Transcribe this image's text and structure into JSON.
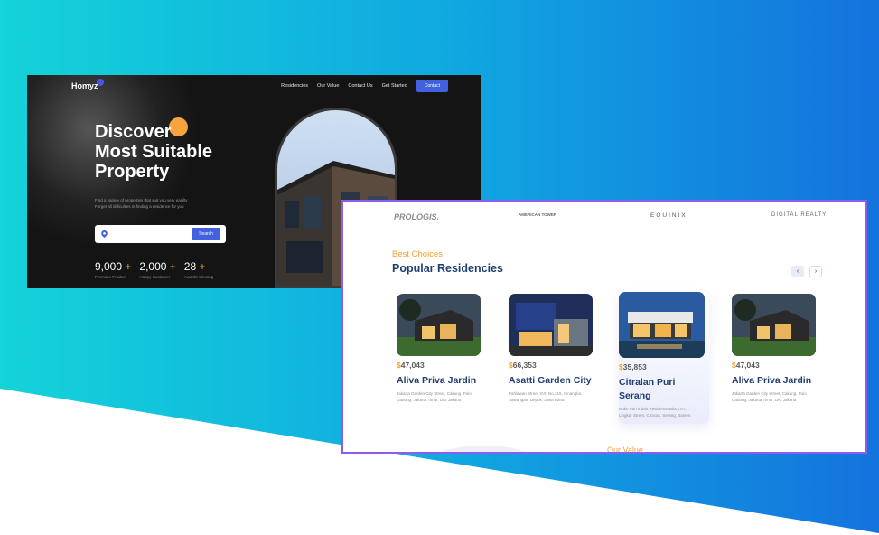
{
  "hero": {
    "logo": "Homyz",
    "nav": [
      "Residencies",
      "Our Value",
      "Contact Us",
      "Get Started"
    ],
    "contact_button": "Contact",
    "headline": [
      "Discover",
      "Most Suitable",
      "Property"
    ],
    "description": [
      "Find a variety of properties that suit you very easilty",
      "Forget all difficulties in finding a residence for you"
    ],
    "search_button": "Search",
    "stats": [
      {
        "value": "9,000",
        "plus": "+",
        "label": "Premium Product"
      },
      {
        "value": "2,000",
        "plus": "+",
        "label": "Happy Customer"
      },
      {
        "value": "28",
        "plus": "+",
        "label": "Awards Winning"
      }
    ]
  },
  "residencies": {
    "partners": [
      "PROLOGIS.",
      "AMERICAN TOWER",
      "EQUINIX",
      "DIGITAL REALTY"
    ],
    "subtitle": "Best Choices",
    "title": "Popular Residencies",
    "prev_icon": "‹",
    "next_icon": "›",
    "cards": [
      {
        "dollar": "$",
        "price": "47,043",
        "name": "Aliva Priva Jardin",
        "address": "Jakarta Garden City Street, Cakung. Pulo Gadung, Jakarta Timur, DKI Jakarta"
      },
      {
        "dollar": "$",
        "price": "66,353",
        "name": "Asatti Garden City",
        "address": "Pahlawan Street XVII No.215, Cinangka, Sawangan, Depok, Jawa Barat"
      },
      {
        "dollar": "$",
        "price": "35,853",
        "name": "Citralan Puri Serang",
        "address": "Ruko Puri Indah Residence Block A7, Lingkar Street, Ciracas, Serang, Banten"
      },
      {
        "dollar": "$",
        "price": "47,043",
        "name": "Aliva Priva Jardin",
        "address": "Jakarta Garden City Street, Cakung. Pulo Gadung, Jakarta Timur, DKI Jakarta"
      }
    ],
    "next_section": "Our Value"
  },
  "colors": {
    "accent_orange": "#f59e2e",
    "primary_blue": "#4161df",
    "title_navy": "#1f3e72",
    "frame_purple": "#8f5cf0"
  }
}
